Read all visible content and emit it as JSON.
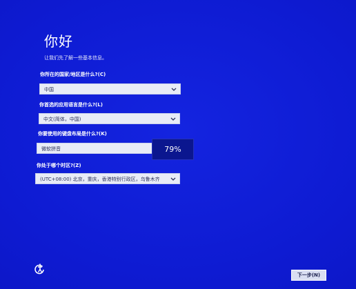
{
  "setup": {
    "title": "你好",
    "subtitle": "让我们先了解一些基本信息。",
    "country": {
      "label": "你所在的国家/地区是什么?(C)",
      "value": "中国"
    },
    "language": {
      "label": "你首选的应用语言是什么?(L)",
      "value": "中文(简体，中国)"
    },
    "keyboard": {
      "label": "你要使用的键盘布局是什么?(K)",
      "value": "微软拼音"
    },
    "timezone": {
      "label": "你处于哪个时区?(Z)",
      "value": "(UTC+08:00) 北京，重庆，香港特别行政区，乌鲁木齐"
    },
    "next_button": "下一步(N)"
  },
  "overlay": {
    "progress": "79%"
  },
  "icons": {
    "accessibility": "accessibility-icon",
    "chevron": "chevron-down-icon"
  },
  "colors": {
    "background": "#0f17c9",
    "field": "#e8ecf7"
  }
}
